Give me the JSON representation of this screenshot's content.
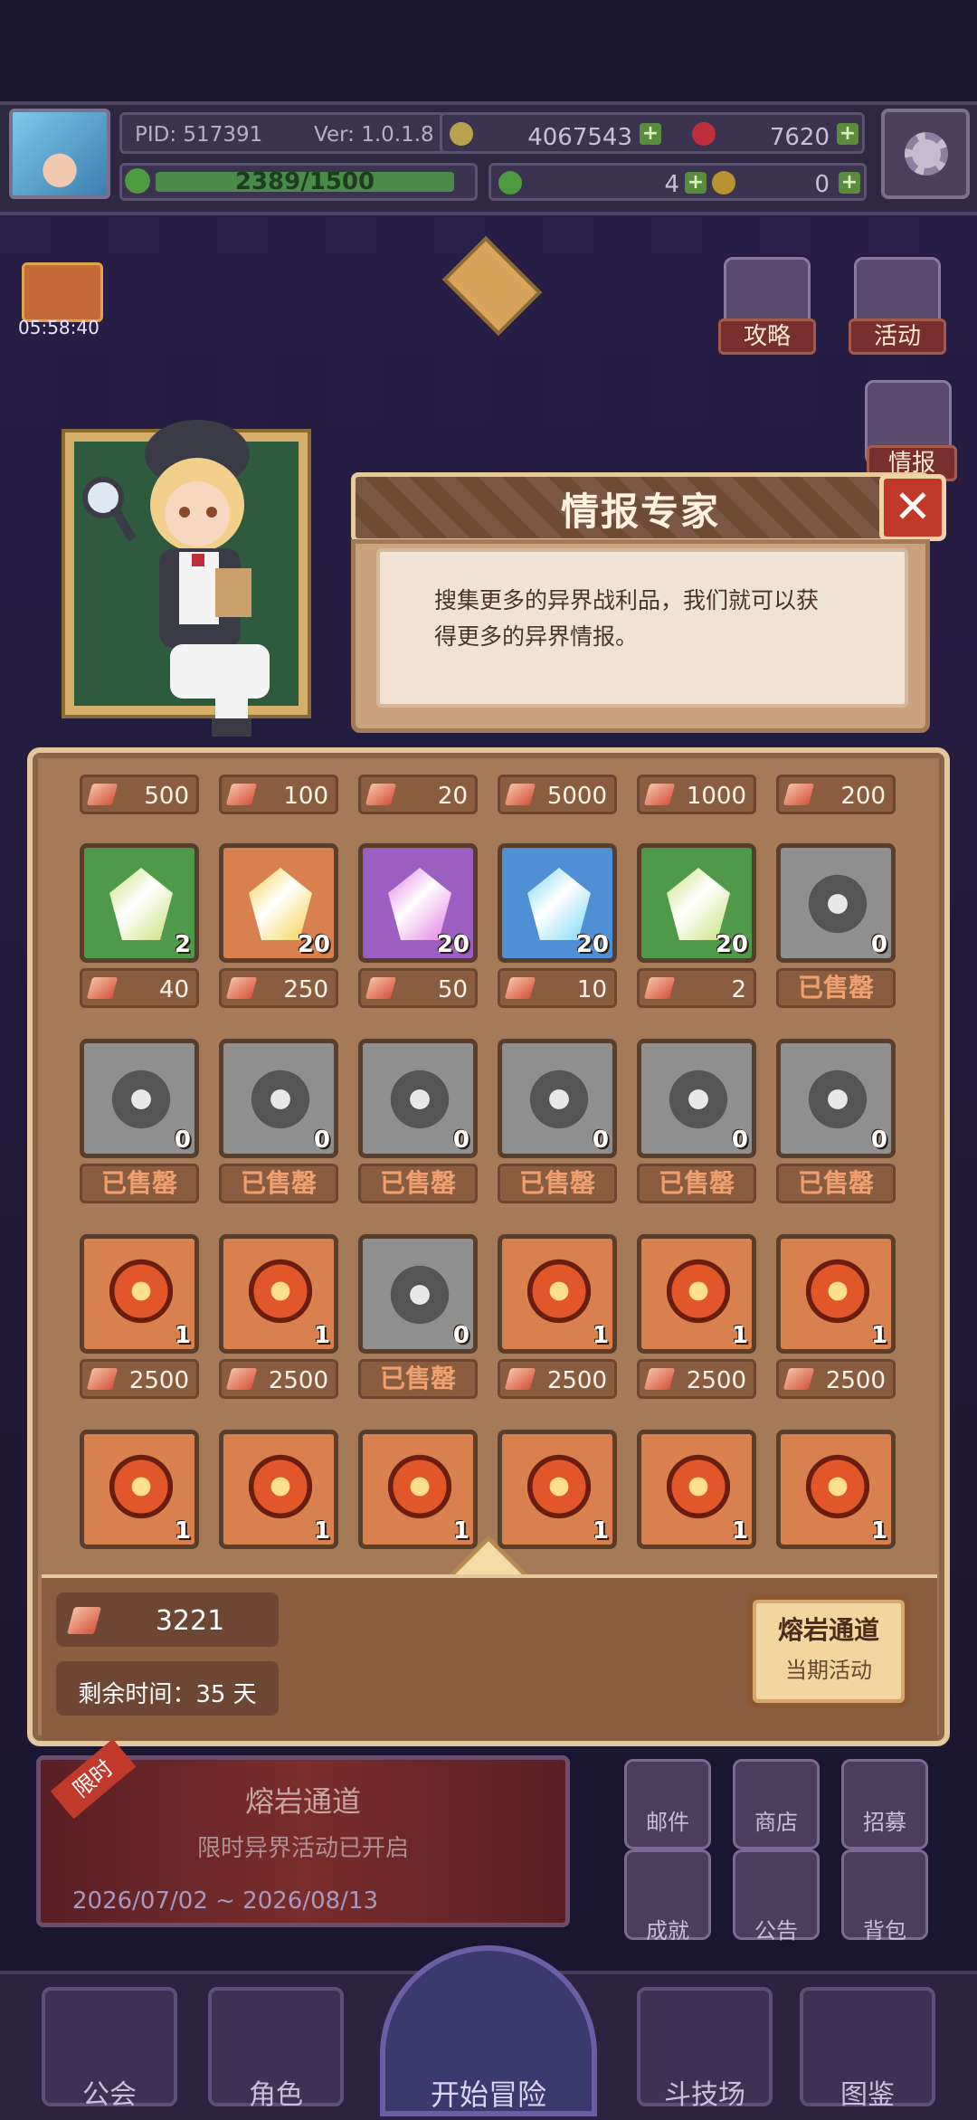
{
  "topbar": {
    "pid": "PID: 517391",
    "version": "Ver: 1.0.1.8",
    "gold": "4067543",
    "gems": "7620",
    "xp": "2389/1500",
    "clover": "4",
    "keys": "0"
  },
  "timer": "05:58:40",
  "side_buttons": {
    "guide": "攻略",
    "activity": "活动",
    "intel": "情报"
  },
  "dialog": {
    "title": "情报专家",
    "close_symbol": "✕",
    "text_line1": "搜集更多的异界战利品，我们就可以获",
    "text_line2": "得更多的异界情报。"
  },
  "shop": {
    "sold_out_label": "已售罄",
    "top_prices": [
      "500",
      "100",
      "20",
      "5000",
      "1000",
      "200"
    ],
    "rows": [
      {
        "items": [
          {
            "icon": "green-crystal-icon",
            "bg": "#4f9a4a",
            "count": "2",
            "price": "40"
          },
          {
            "icon": "gold-gem-icon",
            "bg": "#d9804f",
            "count": "20",
            "price": "250"
          },
          {
            "icon": "purple-gem-icon",
            "bg": "#9b5fc2",
            "count": "20",
            "price": "50"
          },
          {
            "icon": "blue-gem-icon",
            "bg": "#4f8fd6",
            "count": "20",
            "price": "10"
          },
          {
            "icon": "green-gem-icon",
            "bg": "#4f9a4a",
            "count": "20",
            "price": "2"
          },
          {
            "icon": "dagger-icon",
            "bg": "#8f8f8f",
            "count": "0",
            "price": null
          }
        ]
      },
      {
        "items": [
          {
            "icon": "chestplate-icon",
            "bg": "#8f8f8f",
            "count": "0",
            "price": null
          },
          {
            "icon": "shoulder-armor-icon",
            "bg": "#8f8f8f",
            "count": "0",
            "price": null
          },
          {
            "icon": "orb-icon",
            "bg": "#8f8f8f",
            "count": "0",
            "price": null
          },
          {
            "icon": "mace-icon",
            "bg": "#8f8f8f",
            "count": "0",
            "price": null
          },
          {
            "icon": "wings-armor-icon",
            "bg": "#8f8f8f",
            "count": "0",
            "price": null
          },
          {
            "icon": "sword-icon",
            "bg": "#8f8f8f",
            "count": "0",
            "price": null
          }
        ]
      },
      {
        "items": [
          {
            "icon": "lava-helmet-icon",
            "bg": "#d9804f",
            "count": "1",
            "price": "2500"
          },
          {
            "icon": "lava-boots-icon",
            "bg": "#d9804f",
            "count": "1",
            "price": "2500"
          },
          {
            "icon": "gauntlet-icon",
            "bg": "#8f8f8f",
            "count": "0",
            "price": null
          },
          {
            "icon": "lava-glove-icon",
            "bg": "#d9804f",
            "count": "1",
            "price": "2500"
          },
          {
            "icon": "lava-armor-icon",
            "bg": "#d9804f",
            "count": "1",
            "price": "2500"
          },
          {
            "icon": "lava-staff-icon",
            "bg": "#d9804f",
            "count": "1",
            "price": "2500"
          }
        ]
      },
      {
        "items": [
          {
            "icon": "flame-star-icon",
            "bg": "#d9804f",
            "count": "1",
            "price": null
          },
          {
            "icon": "flame-ring-icon",
            "bg": "#d9804f",
            "count": "1",
            "price": null
          },
          {
            "icon": "flame-horse-icon",
            "bg": "#d9804f",
            "count": "1",
            "price": null
          },
          {
            "icon": "flame-necklace-icon",
            "bg": "#d9804f",
            "count": "1",
            "price": null
          },
          {
            "icon": "flame-boots-icon",
            "bg": "#d9804f",
            "count": "1",
            "price": null
          },
          {
            "icon": "flame-spear-icon",
            "bg": "#d9804f",
            "count": "1",
            "price": null
          }
        ]
      }
    ],
    "currency_value": "3221",
    "remaining_time": "剩余时间：35 天",
    "event_button_title": "熔岩通道",
    "event_button_sub": "当期活动"
  },
  "banner": {
    "tag": "限时",
    "title": "熔岩通道",
    "subtitle": "限时异界活动已开启",
    "dates": "2026/07/02 ~ 2026/08/13"
  },
  "mini_buttons": [
    "邮件",
    "商店",
    "招募",
    "成就",
    "公告",
    "背包"
  ],
  "nav": {
    "guild": "公会",
    "character": "角色",
    "start": "开始冒险",
    "arena": "斗技场",
    "codex": "图鉴"
  },
  "colors": {
    "panel": "#a57a58",
    "sold_out_text": "#f0a070",
    "dialog_header": "#6f4a35"
  }
}
